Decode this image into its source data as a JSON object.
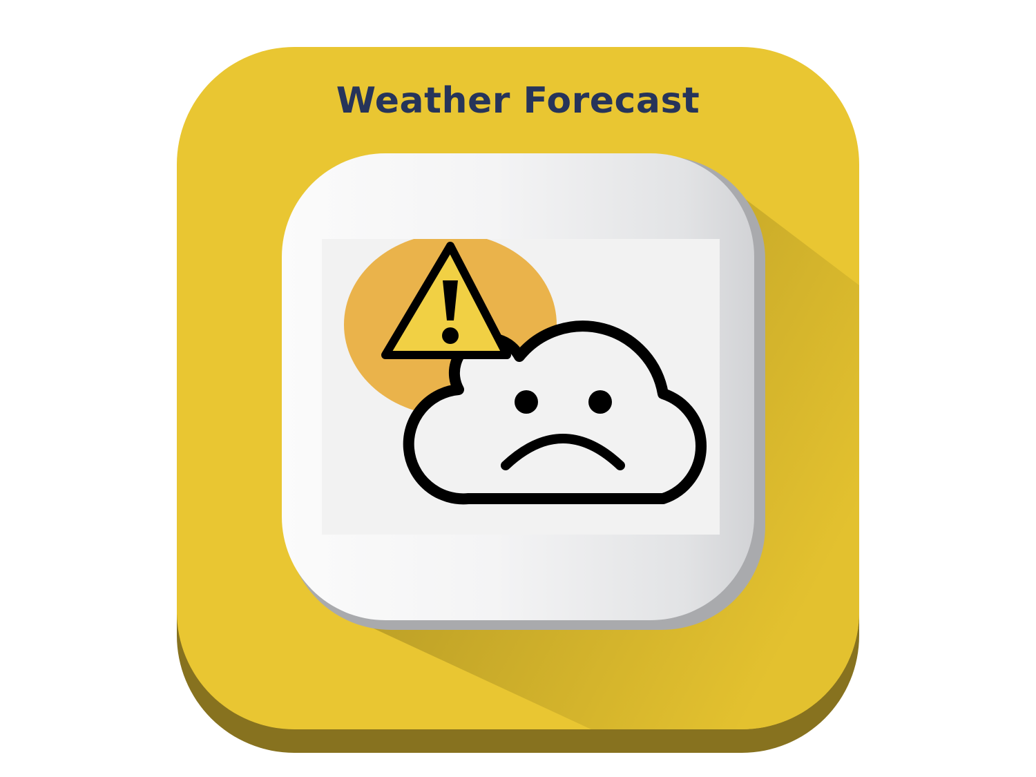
{
  "app": {
    "title": "Weather Forecast"
  },
  "icons": {
    "warning": "warning-triangle-icon",
    "cloud": "sad-cloud-icon"
  },
  "colors": {
    "icon_background": "#e9c632",
    "icon_base_shadow": "#87721f",
    "title_text": "#26345a",
    "tile_face": "#f4f4f5",
    "warning_circle": "#eab34b",
    "warning_triangle": "#f1d044",
    "outline": "#000000"
  }
}
